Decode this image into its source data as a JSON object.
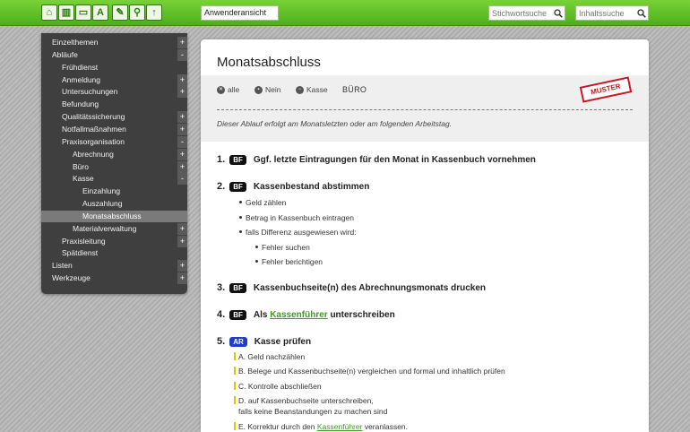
{
  "toolbar": {
    "icons": [
      "home-icon",
      "book-icon",
      "window-icon",
      "font-icon",
      "edit-icon",
      "pin-icon",
      "upload-icon"
    ],
    "view_value": "Anwenderansicht",
    "keyword_placeholder": "Stichwortsuche",
    "content_placeholder": "Inhaltssuche"
  },
  "sidebar": {
    "items": [
      {
        "label": "Einzelthemen",
        "level": 0,
        "toggle": "+"
      },
      {
        "label": "Abläufe",
        "level": 0,
        "toggle": "-"
      },
      {
        "label": "Frühdienst",
        "level": 1,
        "toggle": ""
      },
      {
        "label": "Anmeldung",
        "level": 1,
        "toggle": "+"
      },
      {
        "label": "Untersuchungen",
        "level": 1,
        "toggle": "+"
      },
      {
        "label": "Befundung",
        "level": 1,
        "toggle": ""
      },
      {
        "label": "Qualitätssicherung",
        "level": 1,
        "toggle": "+"
      },
      {
        "label": "Notfallmaßnahmen",
        "level": 1,
        "toggle": "+"
      },
      {
        "label": "Praxisorganisation",
        "level": 1,
        "toggle": "-"
      },
      {
        "label": "Abrechnung",
        "level": 2,
        "toggle": "+"
      },
      {
        "label": "Büro",
        "level": 2,
        "toggle": "+"
      },
      {
        "label": "Kasse",
        "level": 2,
        "toggle": "-"
      },
      {
        "label": "Einzahlung",
        "level": 3,
        "toggle": ""
      },
      {
        "label": "Auszahlung",
        "level": 3,
        "toggle": ""
      },
      {
        "label": "Monatsabschluss",
        "level": 3,
        "toggle": "",
        "active": true
      },
      {
        "label": "Materialverwaltung",
        "level": 2,
        "toggle": "+"
      },
      {
        "label": "Praxisleitung",
        "level": 1,
        "toggle": "+"
      },
      {
        "label": "Spätdienst",
        "level": 1,
        "toggle": ""
      },
      {
        "label": "Listen",
        "level": 0,
        "toggle": "+"
      },
      {
        "label": "Werkzeuge",
        "level": 0,
        "toggle": "+"
      }
    ]
  },
  "main": {
    "title": "Monatsabschluss",
    "filters": {
      "alle": "alle",
      "nein": "Nein",
      "kasse": "Kasse",
      "buero": "BÜRO"
    },
    "stamp": "MUSTER",
    "description": "Dieser Ablauf erfolgt am Monatsletzten oder am folgenden Arbeitstag.",
    "steps": [
      {
        "num": "1.",
        "badge": "BF",
        "text": "Ggf. letzte Eintragungen für den Monat in Kassenbuch vornehmen"
      },
      {
        "num": "2.",
        "badge": "BF",
        "text": "Kassenbestand abstimmen",
        "bullets": [
          "Geld zählen",
          "Betrag in Kassenbuch eintragen",
          "falls Differenz ausgewiesen wird:"
        ],
        "subbullets": [
          "Fehler suchen",
          "Fehler berichtigen"
        ]
      },
      {
        "num": "3.",
        "badge": "BF",
        "text": "Kassenbuchseite(n) des Abrechnungsmonats drucken"
      },
      {
        "num": "4.",
        "badge": "BF",
        "pre": "Als",
        "link": "Kassenführer",
        "post": "unterschreiben"
      },
      {
        "num": "5.",
        "badge": "AR",
        "text": "Kasse prüfen",
        "items": [
          {
            "text": "A. Geld nachzählen"
          },
          {
            "text": "B. Belege und Kassenbuchseite(n) vergleichen und formal und inhaltlich prüfen"
          },
          {
            "text": "C. Kontrolle abschließen"
          },
          {
            "text": "D. auf Kassenbuchseite unterschreiben,",
            "text2": "falls keine Beanstandungen zu machen sind"
          },
          {
            "pre": "E. Korrektur durch den",
            "link": "Kassenführer",
            "post": "veranlassen."
          }
        ]
      }
    ]
  },
  "colors": {
    "accent_green": "#5cbf24",
    "link_green": "#3e9a20",
    "badge_ar": "#1f3fc4",
    "stamp_red": "#c41b22"
  }
}
